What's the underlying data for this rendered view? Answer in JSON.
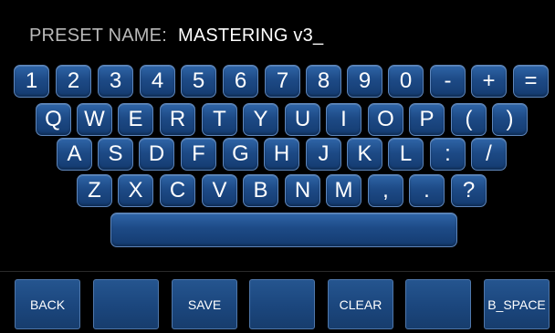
{
  "preset": {
    "label": "PRESET NAME:",
    "value": "MASTERING v3_"
  },
  "keyboard": {
    "row1": [
      "1",
      "2",
      "3",
      "4",
      "5",
      "6",
      "7",
      "8",
      "9",
      "0",
      "-",
      "+",
      "="
    ],
    "row2": [
      "Q",
      "W",
      "E",
      "R",
      "T",
      "Y",
      "U",
      "I",
      "O",
      "P",
      "(",
      ")"
    ],
    "row3": [
      "A",
      "S",
      "D",
      "F",
      "G",
      "H",
      "J",
      "K",
      "L",
      ":",
      "/"
    ],
    "row4": [
      "Z",
      "X",
      "C",
      "V",
      "B",
      "N",
      "M",
      ",",
      ".",
      "?"
    ],
    "space_label": ""
  },
  "soft_keys": {
    "back": "BACK",
    "blank1": "",
    "save": "SAVE",
    "blank2": "",
    "clear": "CLEAR",
    "blank3": "",
    "b_space": "B_SPACE"
  }
}
